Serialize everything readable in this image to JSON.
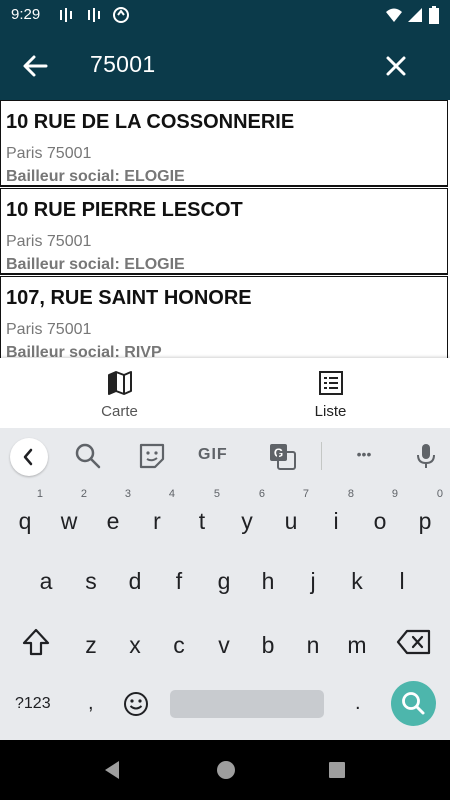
{
  "status_bar": {
    "time": "9:29",
    "icons": [
      "signal-icon",
      "signal-icon",
      "sync-icon",
      "wifi-icon",
      "cellular-icon",
      "battery-icon"
    ]
  },
  "app_bar": {
    "back_icon": "arrow-back-icon",
    "query": "75001",
    "clear_icon": "close-icon"
  },
  "results": [
    {
      "name": "10 RUE DE LA COSSONNERIE",
      "city": "Paris 75001",
      "landlord": "Bailleur social: ELOGIE"
    },
    {
      "name": "10 RUE PIERRE LESCOT",
      "city": "Paris 75001",
      "landlord": "Bailleur social: ELOGIE"
    },
    {
      "name": "107, RUE SAINT HONORE",
      "city": "Paris 75001",
      "landlord": "Bailleur social: RIVP"
    }
  ],
  "bottom_nav": {
    "carte": {
      "label": "Carte",
      "icon": "map-icon"
    },
    "liste": {
      "label": "Liste",
      "icon": "list-icon"
    }
  },
  "keyboard": {
    "toolbar": [
      "back-chevron-icon",
      "search-icon",
      "sticker-icon",
      "gif-icon",
      "translate-icon",
      "more-icon",
      "mic-icon"
    ],
    "gif_label": "GIF",
    "more_label": "•••",
    "row1": [
      {
        "k": "q",
        "n": "1"
      },
      {
        "k": "w",
        "n": "2"
      },
      {
        "k": "e",
        "n": "3"
      },
      {
        "k": "r",
        "n": "4"
      },
      {
        "k": "t",
        "n": "5"
      },
      {
        "k": "y",
        "n": "6"
      },
      {
        "k": "u",
        "n": "7"
      },
      {
        "k": "i",
        "n": "8"
      },
      {
        "k": "o",
        "n": "9"
      },
      {
        "k": "p",
        "n": "0"
      }
    ],
    "row2": [
      "a",
      "s",
      "d",
      "f",
      "g",
      "h",
      "j",
      "k",
      "l"
    ],
    "row3": [
      "z",
      "x",
      "c",
      "v",
      "b",
      "n",
      "m"
    ],
    "sym_label": "?123",
    "comma": ",",
    "period": "."
  },
  "colors": {
    "app_bar": "#0b3a4a",
    "keyboard_bg": "#e8eaed",
    "search_key": "#4db6ac"
  }
}
